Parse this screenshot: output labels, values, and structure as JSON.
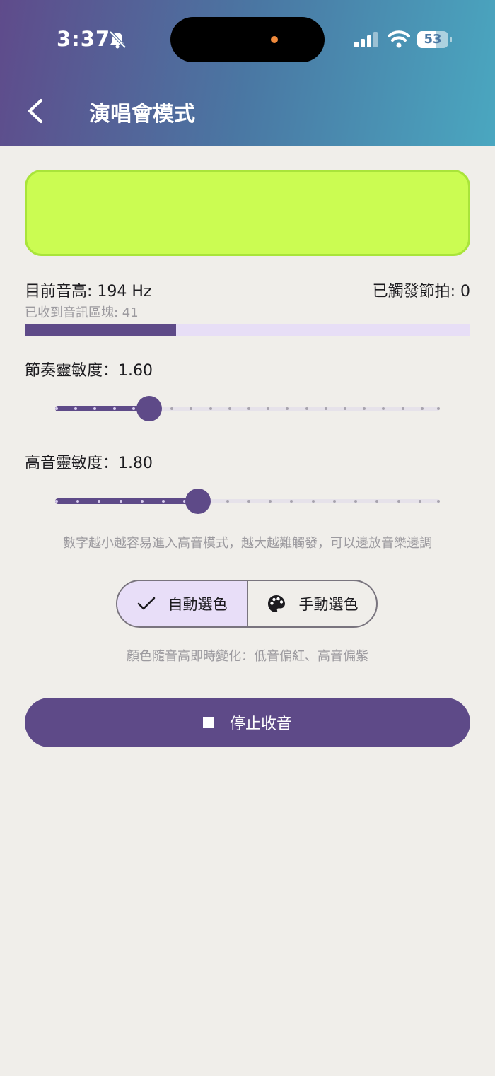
{
  "status_bar": {
    "time": "3:37",
    "battery": "53"
  },
  "header": {
    "title": "演唱會模式"
  },
  "preview": {
    "color": "#cbfc52"
  },
  "stats": {
    "pitch": "目前音高: 194 Hz",
    "beats": "已觸發節拍: 0",
    "chunks": "已收到音訊區塊: 41",
    "level": 0.34
  },
  "sliders": [
    {
      "title": "節奏靈敏度：1.60",
      "value": 1.6,
      "min": 0.5,
      "max": 5.0,
      "steps": 20
    },
    {
      "title": "高音靈敏度：1.80",
      "value": 1.8,
      "min": 0.5,
      "max": 4.0,
      "steps": 18
    }
  ],
  "hint_sensitivity": "數字越小越容易進入高音模式，越大越難觸發，可以邊放音樂邊調",
  "color_mode": {
    "auto_label": "自動選色",
    "manual_label": "手動選色",
    "selected": "auto"
  },
  "hint_color": "顏色隨音高即時變化：低音偏紅、高音偏紫",
  "stop_button": {
    "label": "停止收音"
  },
  "icons": {
    "back": "chevron-left-icon",
    "bell": "bell-slash-icon",
    "check": "check-icon",
    "palette": "palette-icon",
    "stop": "stop-icon"
  },
  "colors": {
    "accent": "#5e4a88",
    "selected_tint": "#e8def8",
    "track": "#e7def6"
  }
}
